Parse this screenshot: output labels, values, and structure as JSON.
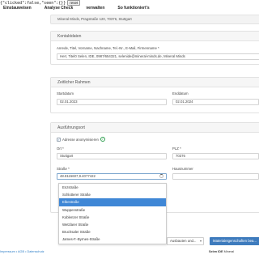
{
  "debug": {
    "state_text": "{\"clicked\":false,\"seen\":{}}",
    "reset_label": "reset"
  },
  "nav": {
    "items": [
      "Einstauweisen",
      "Analyse Check",
      "verwalten",
      "So funktioniert's"
    ]
  },
  "address_bar": {
    "text": "Mineral Minds, Pragstraße 120, 70376, Stuttgart"
  },
  "kontakt": {
    "heading": "Kontaktdaten",
    "field_label": "Anrede, Titel, Vorname, Nachname, Tel.-Nr., E-Mail, Firmenname *",
    "field_value": "Herr, Titel0 Selen, IDE, 0987/654321, selenide@mineral-minds.de, Mineral Minds"
  },
  "zeit": {
    "heading": "Zeitlicher Rahmen",
    "start_label": "Startdatum",
    "start_value": "02.01.2023",
    "end_label": "Enddatum",
    "end_value": "02.01.2024"
  },
  "ort": {
    "heading": "Ausführungsort",
    "anonym_label": "Adresse anonymisieren",
    "anonym_checkmark": "✓",
    "info_icon_glyph": "✓",
    "ort_label": "Ort *",
    "ort_value": "Stuttgart",
    "plz_label": "PLZ *",
    "plz_value": "70376",
    "strasse_label": "Straße *",
    "strasse_value": "48.8115607,9.4077422",
    "hausnummer_label": "Hausnummer"
  },
  "dropdown": {
    "items": [
      "Enzstraße",
      "Schlotterer Straße",
      "Elbestraße",
      "Wuppenstraße",
      "Koblenzer Straße",
      "Wetzlarer Straße",
      "Bruchsaler Straße",
      "James-F.-Byrnes-Straße"
    ],
    "selected": "Elbestraße"
  },
  "bottom": {
    "ausbau_label": "Ausbauten und...",
    "ausbau_caret": "▾",
    "material_button": "Materialeigenschaften bea..."
  },
  "footer": {
    "links": "Impressum • AGB • Datenschutz",
    "brand_name": "Selen IDE",
    "brand_suffix": "Mineral"
  },
  "colors": {
    "accent": "#3e7bbd",
    "dropdown_highlight": "#3f87d6",
    "check_green": "#2e9e4f"
  }
}
